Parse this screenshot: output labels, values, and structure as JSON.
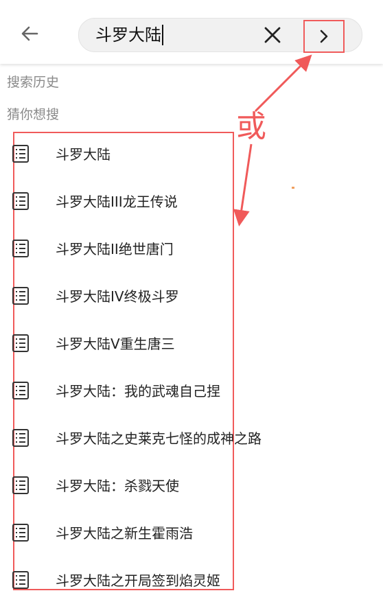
{
  "search": {
    "value": "斗罗大陆"
  },
  "sections": {
    "history_label": "搜索历史",
    "guess_label": "猜你想搜"
  },
  "suggestions": [
    "斗罗大陆",
    "斗罗大陆III龙王传说",
    "斗罗大陆II绝世唐门",
    "斗罗大陆IV终极斗罗",
    "斗罗大陆V重生唐三",
    "斗罗大陆：我的武魂自己捏",
    "斗罗大陆之史莱克七怪的成神之路",
    "斗罗大陆：杀戮天使",
    "斗罗大陆之新生霍雨浩",
    "斗罗大陆之开局签到焰灵姬"
  ],
  "annotation": {
    "or_text": "或"
  },
  "icons": {
    "back": "back-arrow-icon",
    "clear": "close-icon",
    "go": "chevron-right-icon",
    "item": "book-list-icon"
  },
  "colors": {
    "annotation": "#f05a5a",
    "label_gray": "#8a8a8a",
    "search_bg": "#f1f1f1"
  }
}
